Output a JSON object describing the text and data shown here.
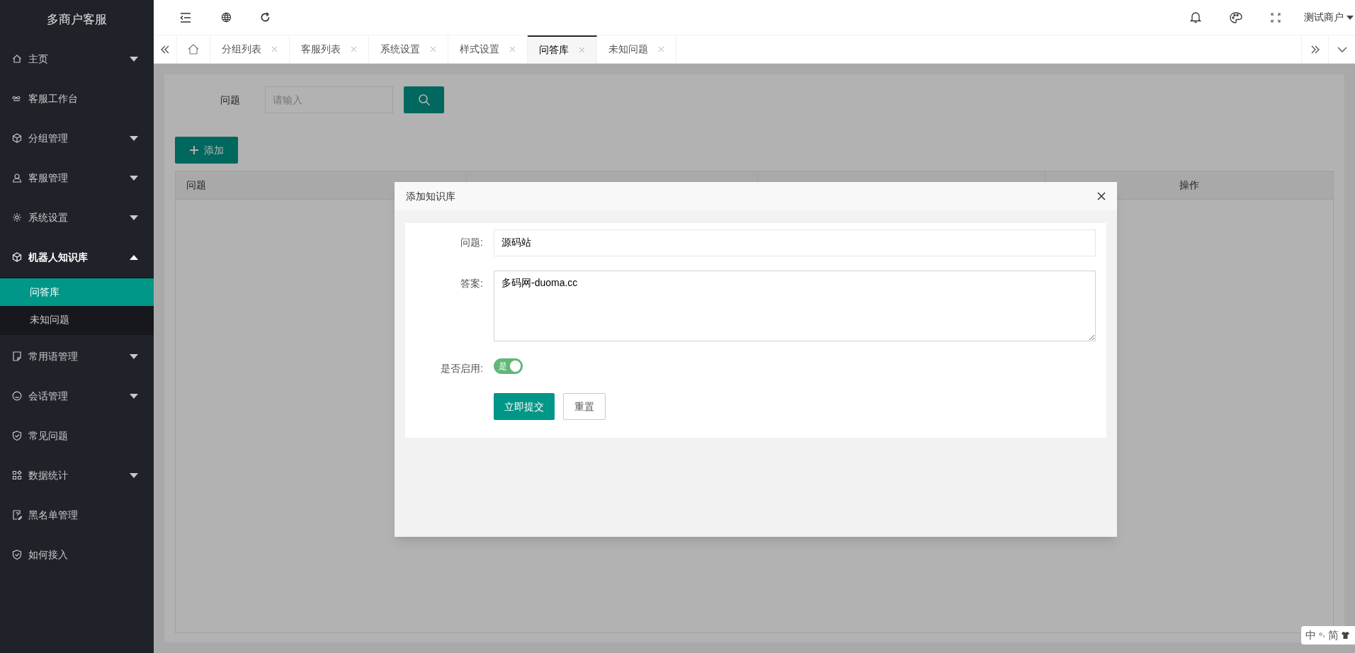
{
  "sidebar": {
    "title": "多商户客服",
    "items": [
      {
        "kind": "menu",
        "label": "主页",
        "expanded": false
      },
      {
        "kind": "link",
        "label": "客服工作台"
      },
      {
        "kind": "menu",
        "label": "分组管理",
        "expanded": false
      },
      {
        "kind": "menu",
        "label": "客服管理",
        "expanded": false
      },
      {
        "kind": "menu",
        "label": "系统设置",
        "expanded": false
      },
      {
        "kind": "menu",
        "label": "机器人知识库",
        "expanded": true,
        "children": [
          {
            "label": "问答库",
            "selected": true
          },
          {
            "label": "未知问题",
            "selected": false
          }
        ]
      },
      {
        "kind": "menu",
        "label": "常用语管理",
        "expanded": false
      },
      {
        "kind": "menu",
        "label": "会话管理",
        "expanded": false
      },
      {
        "kind": "link",
        "label": "常见问题"
      },
      {
        "kind": "menu",
        "label": "数据统计",
        "expanded": false
      },
      {
        "kind": "link",
        "label": "黑名单管理"
      },
      {
        "kind": "link",
        "label": "如何接入"
      }
    ]
  },
  "header": {
    "user": "测试商户"
  },
  "tabs": [
    {
      "label": "分组列表",
      "selected": false
    },
    {
      "label": "客服列表",
      "selected": false
    },
    {
      "label": "系统设置",
      "selected": false
    },
    {
      "label": "样式设置",
      "selected": false
    },
    {
      "label": "问答库",
      "selected": true
    },
    {
      "label": "未知问题",
      "selected": false
    }
  ],
  "search": {
    "label": "问题",
    "placeholder": "请输入"
  },
  "add_button": "添加",
  "table": {
    "columns": [
      "问题",
      "操作"
    ]
  },
  "dialog": {
    "title": "添加知识库",
    "fields": [
      {
        "kind": "input",
        "label": "问题:",
        "value": "源码站"
      },
      {
        "kind": "textarea",
        "label": "答案:",
        "value": "多码网-duoma.cc"
      },
      {
        "kind": "switch",
        "label": "是否启用:",
        "text": "是",
        "on": true
      }
    ],
    "buttons": [
      {
        "kind": "primary",
        "label": "立即提交"
      },
      {
        "kind": "plain",
        "label": "重置"
      }
    ]
  },
  "ime": {
    "mode": "中",
    "script": "简"
  }
}
